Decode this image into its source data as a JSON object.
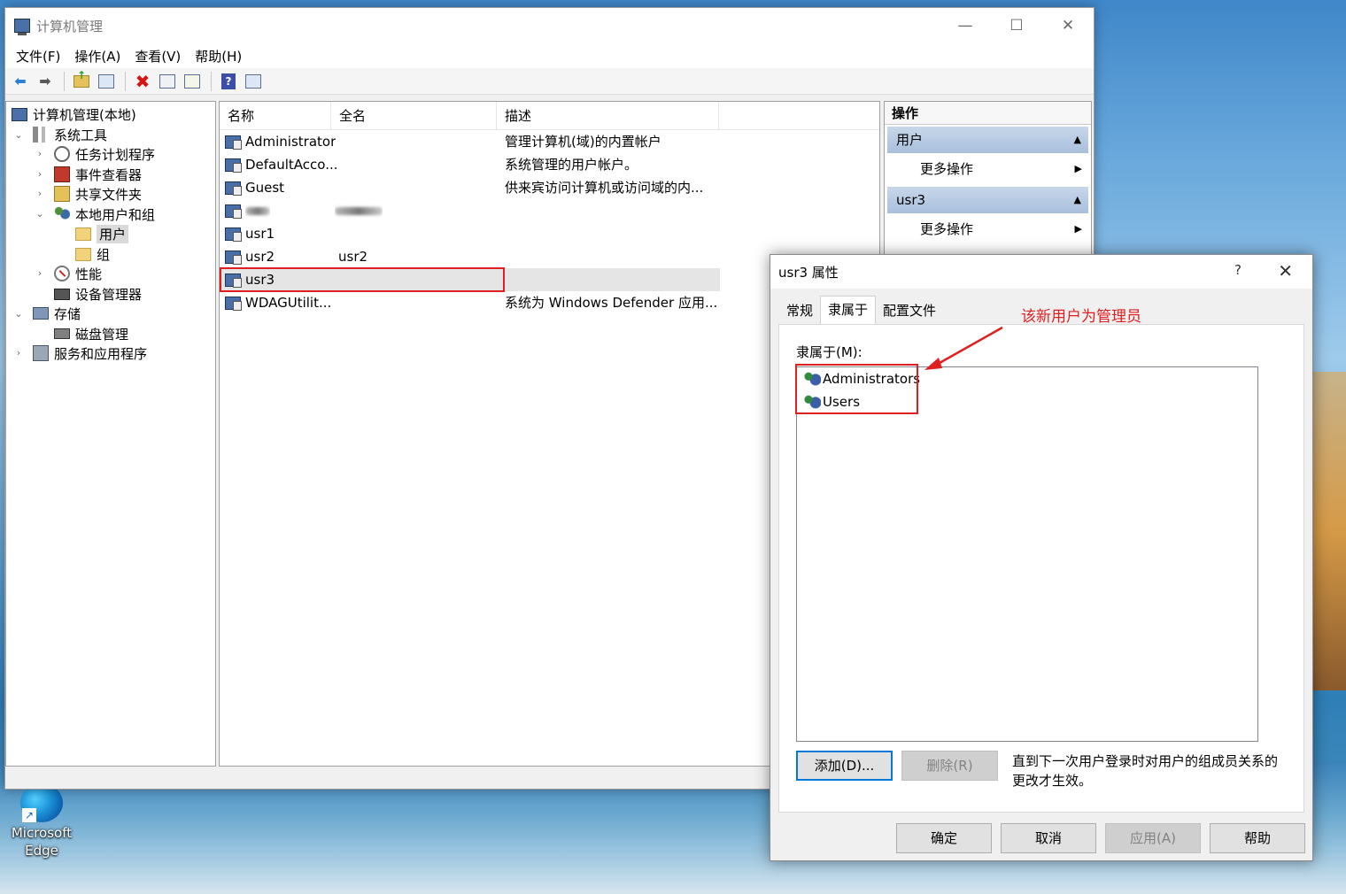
{
  "desktop": {
    "edge_label_1": "Microsoft",
    "edge_label_2": "Edge"
  },
  "window": {
    "title": "计算机管理",
    "controls": {
      "minimize": "—",
      "maximize": "☐",
      "close": "✕"
    },
    "menu": [
      "文件(F)",
      "操作(A)",
      "查看(V)",
      "帮助(H)"
    ]
  },
  "tree": {
    "root": "计算机管理(本地)",
    "system_tools": "系统工具",
    "task_scheduler": "任务计划程序",
    "event_viewer": "事件查看器",
    "shared_folders": "共享文件夹",
    "local_users_groups": "本地用户和组",
    "users": "用户",
    "groups": "组",
    "performance": "性能",
    "device_manager": "设备管理器",
    "storage": "存储",
    "disk_management": "磁盘管理",
    "services_apps": "服务和应用程序"
  },
  "list": {
    "headers": {
      "name": "名称",
      "fullname": "全名",
      "description": "描述"
    },
    "rows": [
      {
        "name": "Administrator",
        "fullname": "",
        "description": "管理计算机(域)的内置帐户"
      },
      {
        "name": "DefaultAcco...",
        "fullname": "",
        "description": "系统管理的用户帐户。"
      },
      {
        "name": "Guest",
        "fullname": "",
        "description": "供来宾访问计算机或访问域的内..."
      },
      {
        "name": "",
        "fullname": "",
        "description": ""
      },
      {
        "name": "usr1",
        "fullname": "",
        "description": ""
      },
      {
        "name": "usr2",
        "fullname": "usr2",
        "description": ""
      },
      {
        "name": "usr3",
        "fullname": "",
        "description": ""
      },
      {
        "name": "WDAGUtilit...",
        "fullname": "",
        "description": "系统为 Windows Defender 应用..."
      }
    ]
  },
  "actions": {
    "title": "操作",
    "section1": "用户",
    "section1_more": "更多操作",
    "section2": "usr3",
    "section2_more": "更多操作"
  },
  "dialog": {
    "title": "usr3 属性",
    "help": "?",
    "close": "✕",
    "tabs": [
      "常规",
      "隶属于",
      "配置文件"
    ],
    "member_label": "隶属于(M):",
    "members": [
      "Administrators",
      "Users"
    ],
    "add_button": "添加(D)...",
    "remove_button": "删除(R)",
    "note": "直到下一次用户登录时对用户的组成员关系的更改才生效。",
    "ok": "确定",
    "cancel": "取消",
    "apply": "应用(A)",
    "help_button": "帮助"
  },
  "annotation": {
    "text": "该新用户为管理员",
    "color": "#e02020"
  }
}
